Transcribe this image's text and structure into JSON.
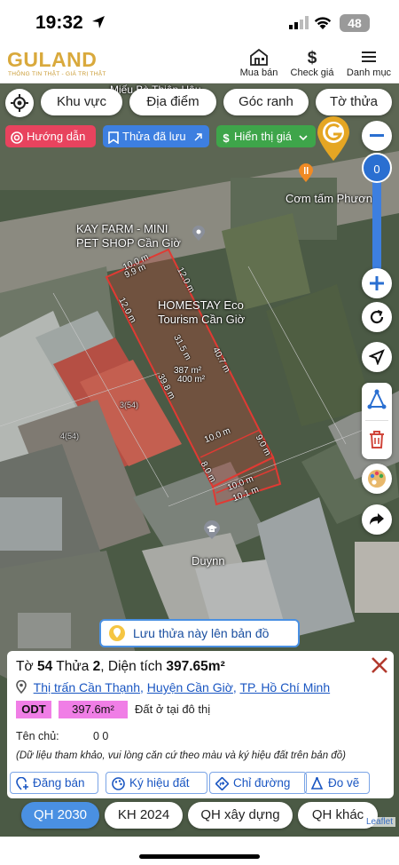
{
  "status": {
    "time": "19:32",
    "battery": "48"
  },
  "header": {
    "logo": "GULAND",
    "logo_sub": "THÔNG TIN THẬT - GIÁ TRỊ THẬT",
    "nav": [
      {
        "label": "Mua bán",
        "icon": "house-icon"
      },
      {
        "label": "Check giá",
        "icon": "dollar-icon"
      },
      {
        "label": "Danh mục",
        "icon": "menu-icon"
      }
    ]
  },
  "filters": [
    "Khu vực",
    "Địa điểm",
    "Góc ranh",
    "Tờ thửa"
  ],
  "chips": {
    "guide": "Hướng dẫn",
    "saved": "Thửa đã lưu",
    "price": "Hiển thị giá",
    "colors": {
      "guide": "#e8435e",
      "saved": "#3d7fe0",
      "price": "#3ea54a"
    }
  },
  "zoom": {
    "level": "0"
  },
  "map_labels": {
    "top_street": "Miếu Bà Thiên Hậu",
    "restaurant": "Cơm tấm Phương",
    "shop1": "KAY FARM - MINI",
    "shop2": "PET SHOP Cần Giờ",
    "homestay1": "HOMESTAY Eco",
    "homestay2": "Tourism Cần Giờ",
    "poi": "Duynn",
    "parcel_no_1": "3(54)",
    "parcel_no_2": "4(54)"
  },
  "dimensions": {
    "top_a": "10.0 m",
    "top_b": "9.9 m",
    "right_top": "12.0 m",
    "left_top": "12.0 m",
    "center": "31.5 m",
    "area_a": "387 m²",
    "area_b": "400 m²",
    "long_right": "40.7 m",
    "long_left": "39.8 m",
    "mid_width": "10.0 m",
    "right_lower": "9.0 m",
    "left_lower": "8.0 m",
    "bottom_a": "10.0 m",
    "bottom_b": "10.1 m"
  },
  "save_button": "Lưu thửa này lên bản đồ",
  "parcel": {
    "sheet_label": "Tờ",
    "sheet_no": "54",
    "plot_label": "Thửa",
    "plot_no": "2",
    "area_label": "Diện tích",
    "area": "397.65m²",
    "ward": "Thị trấn Cần Thạnh",
    "district": "Huyện Cần Giờ",
    "city": "TP. Hồ Chí Minh",
    "land_code": "ODT",
    "land_area": "397.6m²",
    "land_desc": "Đất ở tại đô thị",
    "owner_label": "Tên chủ:",
    "owner_value": "0 0",
    "note": "(Dữ liệu tham khảo, vui lòng căn cứ theo màu và ký hiệu đất trên bản đồ)"
  },
  "actions": [
    "Đăng bán",
    "Ký hiệu đất",
    "Chỉ đường",
    "Đo vẽ"
  ],
  "plan_tabs": [
    "QH 2030",
    "KH 2024",
    "QH xây dựng",
    "QH khác"
  ],
  "attribution": "Leaflet"
}
